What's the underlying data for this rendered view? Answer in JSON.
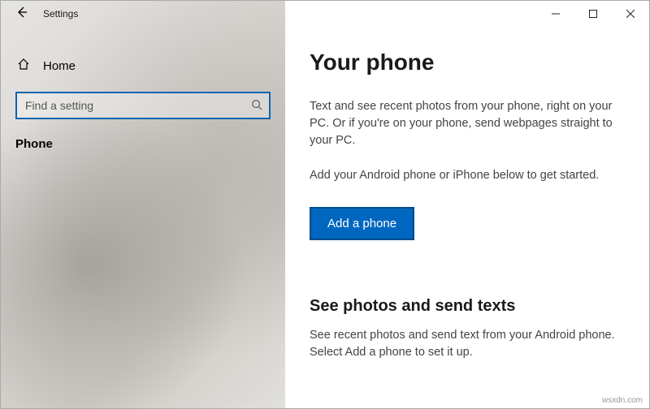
{
  "window": {
    "title": "Settings"
  },
  "sidebar": {
    "home_label": "Home",
    "search_placeholder": "Find a setting",
    "nav_item": "Phone"
  },
  "main": {
    "heading": "Your phone",
    "description1": "Text and see recent photos from your phone, right on your PC. Or if you're on your phone, send webpages straight to your PC.",
    "description2": "Add your Android phone or iPhone below to get started.",
    "add_button": "Add a phone",
    "section_heading": "See photos and send texts",
    "section_description": "See recent photos and send text from your Android phone. Select Add a phone to set it up."
  },
  "watermark": "wsxdn.com"
}
